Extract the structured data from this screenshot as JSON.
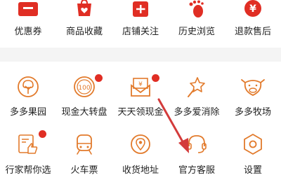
{
  "top_row": [
    {
      "icon": "coupon-icon",
      "label": "优惠券"
    },
    {
      "icon": "favorite-goods-icon",
      "label": "商品收藏"
    },
    {
      "icon": "store-follow-icon",
      "label": "店铺关注"
    },
    {
      "icon": "footprint-icon",
      "label": "历史浏览"
    },
    {
      "icon": "refund-icon",
      "label": "退款售后"
    }
  ],
  "row1": [
    {
      "icon": "orchard-tree-icon",
      "label": "多多果园"
    },
    {
      "icon": "lucky-wheel-coin-icon",
      "label": "现金大转盘",
      "badge": true
    },
    {
      "icon": "daily-cash-envelope-icon",
      "label": "天天领现金",
      "badge": true
    },
    {
      "icon": "star-wand-icon",
      "label": "多多爱消除"
    },
    {
      "icon": "cow-face-icon",
      "label": "多多牧场"
    }
  ],
  "row2": [
    {
      "icon": "expert-pick-thumbs-icon",
      "label": "行家帮你选",
      "badge": true
    },
    {
      "icon": "train-icon",
      "label": "火车票"
    },
    {
      "icon": "location-pin-icon",
      "label": "收货地址"
    },
    {
      "icon": "headset-service-icon",
      "label": "官方客服"
    },
    {
      "icon": "settings-gear-icon",
      "label": "设置"
    }
  ],
  "colors": {
    "brand_red": "#e02e24",
    "icon_orange": "#e27a2b",
    "arrow_red": "#d33b3b"
  }
}
